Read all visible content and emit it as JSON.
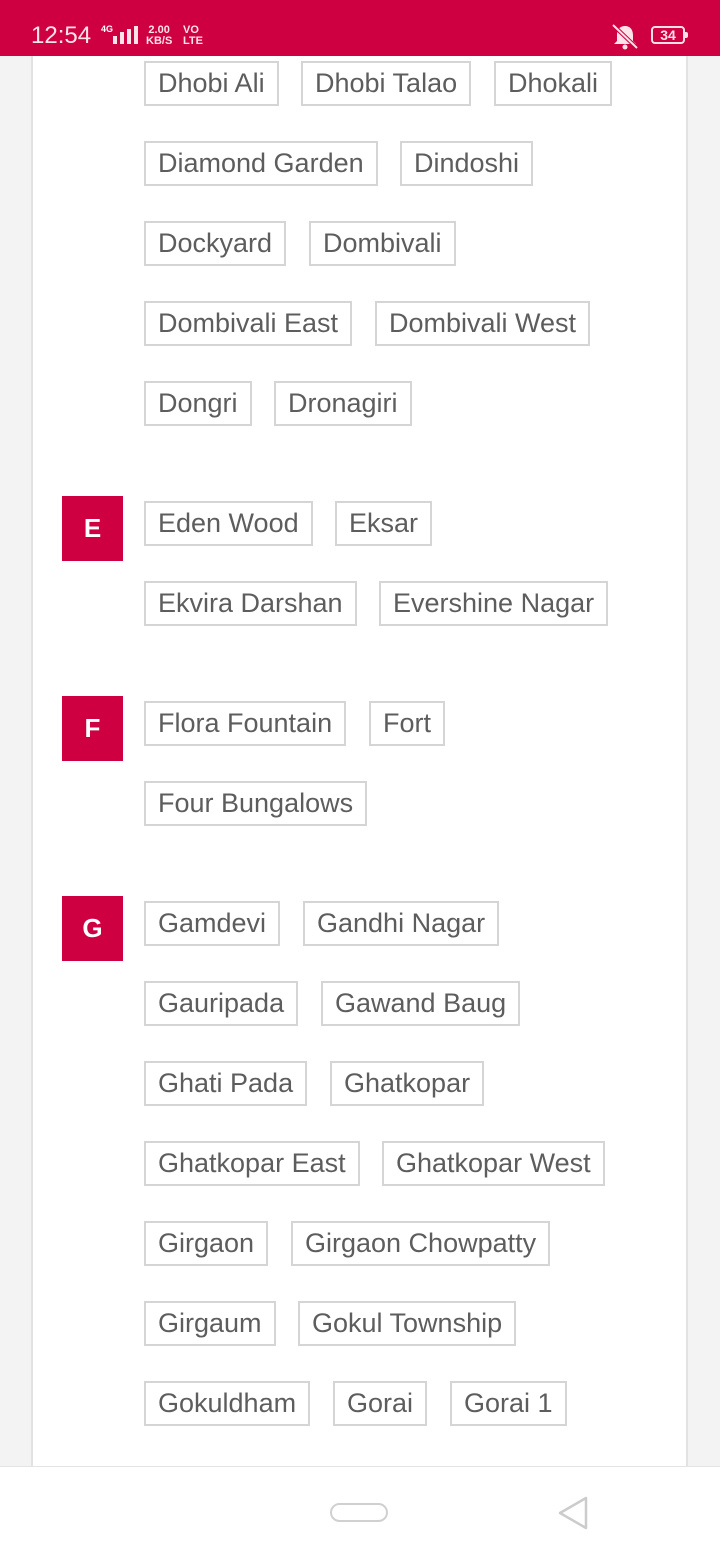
{
  "status_bar": {
    "time": "12:54",
    "network": "4G",
    "speed_value": "2.00",
    "speed_unit": "KB/S",
    "volte_top": "VO",
    "volte_bottom": "LTE",
    "battery": "34",
    "accent_color": "#cf0042"
  },
  "sections": [
    {
      "letter": "",
      "items": [
        "Dhobi Ali",
        "Dhobi Talao",
        "Dhokali",
        "Diamond Garden",
        "Dindoshi",
        "Dockyard",
        "Dombivali",
        "Dombivali East",
        "Dombivali West",
        "Dongri",
        "Dronagiri"
      ]
    },
    {
      "letter": "E",
      "items": [
        "Eden Wood",
        "Eksar",
        "Ekvira Darshan",
        "Evershine Nagar"
      ]
    },
    {
      "letter": "F",
      "items": [
        "Flora Fountain",
        "Fort",
        "Four Bungalows"
      ]
    },
    {
      "letter": "G",
      "items": [
        "Gamdevi",
        "Gandhi Nagar",
        "Gauripada",
        "Gawand Baug",
        "Ghati Pada",
        "Ghatkopar",
        "Ghatkopar East",
        "Ghatkopar West",
        "Girgaon",
        "Girgaon Chowpatty",
        "Girgaum",
        "Gokul Township",
        "Gokuldham",
        "Gorai",
        "Gorai 1"
      ]
    }
  ],
  "nav_bar": {
    "home_icon": "home-pill-icon",
    "back_icon": "back-triangle-icon"
  }
}
